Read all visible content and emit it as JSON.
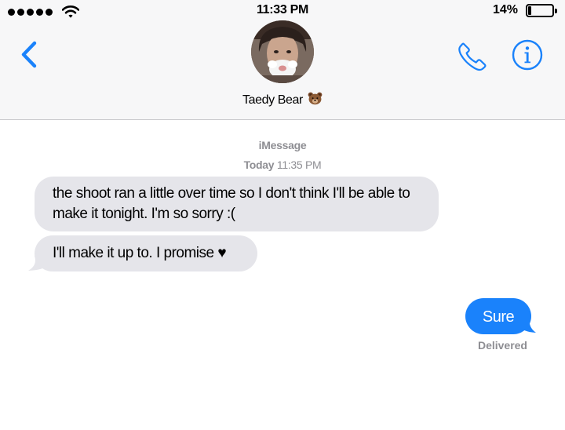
{
  "status_bar": {
    "time": "11:33 PM",
    "battery_percent": "14%",
    "signal_icon": "signal-dots-icon",
    "wifi_icon": "wifi-icon",
    "battery_icon": "battery-icon"
  },
  "header": {
    "back_icon": "chevron-left-icon",
    "contact_name": "Taedy Bear",
    "contact_emoji": "bear-face-emoji",
    "call_icon": "phone-icon",
    "info_icon": "info-icon"
  },
  "conversation": {
    "service": "iMessage",
    "timestamp_day": "Today",
    "timestamp_time": "11:35 PM",
    "messages": [
      {
        "direction": "incoming",
        "text": "the shoot ran a little over time so I don't think I'll be able to make it tonight. I'm so sorry :("
      },
      {
        "direction": "incoming",
        "text": "I'll make it up to. I promise ♥"
      },
      {
        "direction": "outgoing",
        "text": "Sure"
      }
    ],
    "delivery_status": "Delivered"
  },
  "colors": {
    "accent": "#1a82fb",
    "incoming_bubble": "#e5e5ea",
    "header_bg": "#f7f7f8",
    "meta_text": "#8e8e93"
  }
}
